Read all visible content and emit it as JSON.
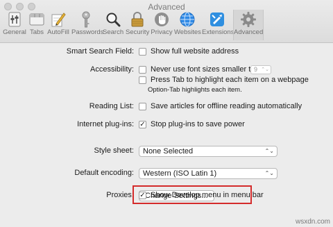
{
  "window": {
    "title": "Advanced"
  },
  "toolbar": [
    {
      "label": "General",
      "icon": "general-icon"
    },
    {
      "label": "Tabs",
      "icon": "tabs-icon"
    },
    {
      "label": "AutoFill",
      "icon": "autofill-icon"
    },
    {
      "label": "Passwords",
      "icon": "passwords-icon"
    },
    {
      "label": "Search",
      "icon": "search-icon"
    },
    {
      "label": "Security",
      "icon": "security-icon"
    },
    {
      "label": "Privacy",
      "icon": "privacy-icon"
    },
    {
      "label": "Websites",
      "icon": "websites-icon"
    },
    {
      "label": "Extensions",
      "icon": "extensions-icon"
    },
    {
      "label": "Advanced",
      "icon": "advanced-icon",
      "selected": true
    }
  ],
  "settings": {
    "smart_search": {
      "label": "Smart Search Field:",
      "option": "Show full website address",
      "checked": false
    },
    "accessibility": {
      "label": "Accessibility:",
      "font_size_option": "Never use font sizes smaller than",
      "font_size_value": "9",
      "tab_option": "Press Tab to highlight each item on a webpage",
      "tab_hint": "Option-Tab highlights each item."
    },
    "reading_list": {
      "label": "Reading List:",
      "option": "Save articles for offline reading automatically"
    },
    "plugins": {
      "label": "Internet plug-ins:",
      "option": "Stop plug-ins to save power",
      "checked": true
    },
    "style_sheet": {
      "label": "Style sheet:",
      "value": "None Selected"
    },
    "encoding": {
      "label": "Default encoding:",
      "value": "Western (ISO Latin 1)"
    },
    "proxies": {
      "label": "Proxies:",
      "button": "Change Settings..."
    },
    "develop": {
      "option": "Show Develop menu in menu bar",
      "checked": true
    }
  },
  "check_glyph": "✓",
  "popup_arrow": "⌃⌄",
  "watermark": "wsxdn.com",
  "colors": {
    "highlight": "#d42b2b",
    "toolbar_selected": "#d6d6d6"
  }
}
